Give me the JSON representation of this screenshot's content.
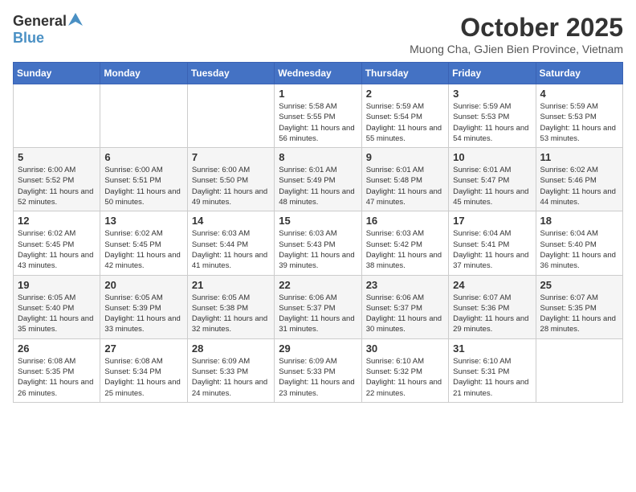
{
  "header": {
    "logo_general": "General",
    "logo_blue": "Blue",
    "month_title": "October 2025",
    "location": "Muong Cha, GJien Bien Province, Vietnam"
  },
  "days_of_week": [
    "Sunday",
    "Monday",
    "Tuesday",
    "Wednesday",
    "Thursday",
    "Friday",
    "Saturday"
  ],
  "weeks": [
    [
      {
        "day": "",
        "info": ""
      },
      {
        "day": "",
        "info": ""
      },
      {
        "day": "",
        "info": ""
      },
      {
        "day": "1",
        "info": "Sunrise: 5:58 AM\nSunset: 5:55 PM\nDaylight: 11 hours and 56 minutes."
      },
      {
        "day": "2",
        "info": "Sunrise: 5:59 AM\nSunset: 5:54 PM\nDaylight: 11 hours and 55 minutes."
      },
      {
        "day": "3",
        "info": "Sunrise: 5:59 AM\nSunset: 5:53 PM\nDaylight: 11 hours and 54 minutes."
      },
      {
        "day": "4",
        "info": "Sunrise: 5:59 AM\nSunset: 5:53 PM\nDaylight: 11 hours and 53 minutes."
      }
    ],
    [
      {
        "day": "5",
        "info": "Sunrise: 6:00 AM\nSunset: 5:52 PM\nDaylight: 11 hours and 52 minutes."
      },
      {
        "day": "6",
        "info": "Sunrise: 6:00 AM\nSunset: 5:51 PM\nDaylight: 11 hours and 50 minutes."
      },
      {
        "day": "7",
        "info": "Sunrise: 6:00 AM\nSunset: 5:50 PM\nDaylight: 11 hours and 49 minutes."
      },
      {
        "day": "8",
        "info": "Sunrise: 6:01 AM\nSunset: 5:49 PM\nDaylight: 11 hours and 48 minutes."
      },
      {
        "day": "9",
        "info": "Sunrise: 6:01 AM\nSunset: 5:48 PM\nDaylight: 11 hours and 47 minutes."
      },
      {
        "day": "10",
        "info": "Sunrise: 6:01 AM\nSunset: 5:47 PM\nDaylight: 11 hours and 45 minutes."
      },
      {
        "day": "11",
        "info": "Sunrise: 6:02 AM\nSunset: 5:46 PM\nDaylight: 11 hours and 44 minutes."
      }
    ],
    [
      {
        "day": "12",
        "info": "Sunrise: 6:02 AM\nSunset: 5:45 PM\nDaylight: 11 hours and 43 minutes."
      },
      {
        "day": "13",
        "info": "Sunrise: 6:02 AM\nSunset: 5:45 PM\nDaylight: 11 hours and 42 minutes."
      },
      {
        "day": "14",
        "info": "Sunrise: 6:03 AM\nSunset: 5:44 PM\nDaylight: 11 hours and 41 minutes."
      },
      {
        "day": "15",
        "info": "Sunrise: 6:03 AM\nSunset: 5:43 PM\nDaylight: 11 hours and 39 minutes."
      },
      {
        "day": "16",
        "info": "Sunrise: 6:03 AM\nSunset: 5:42 PM\nDaylight: 11 hours and 38 minutes."
      },
      {
        "day": "17",
        "info": "Sunrise: 6:04 AM\nSunset: 5:41 PM\nDaylight: 11 hours and 37 minutes."
      },
      {
        "day": "18",
        "info": "Sunrise: 6:04 AM\nSunset: 5:40 PM\nDaylight: 11 hours and 36 minutes."
      }
    ],
    [
      {
        "day": "19",
        "info": "Sunrise: 6:05 AM\nSunset: 5:40 PM\nDaylight: 11 hours and 35 minutes."
      },
      {
        "day": "20",
        "info": "Sunrise: 6:05 AM\nSunset: 5:39 PM\nDaylight: 11 hours and 33 minutes."
      },
      {
        "day": "21",
        "info": "Sunrise: 6:05 AM\nSunset: 5:38 PM\nDaylight: 11 hours and 32 minutes."
      },
      {
        "day": "22",
        "info": "Sunrise: 6:06 AM\nSunset: 5:37 PM\nDaylight: 11 hours and 31 minutes."
      },
      {
        "day": "23",
        "info": "Sunrise: 6:06 AM\nSunset: 5:37 PM\nDaylight: 11 hours and 30 minutes."
      },
      {
        "day": "24",
        "info": "Sunrise: 6:07 AM\nSunset: 5:36 PM\nDaylight: 11 hours and 29 minutes."
      },
      {
        "day": "25",
        "info": "Sunrise: 6:07 AM\nSunset: 5:35 PM\nDaylight: 11 hours and 28 minutes."
      }
    ],
    [
      {
        "day": "26",
        "info": "Sunrise: 6:08 AM\nSunset: 5:35 PM\nDaylight: 11 hours and 26 minutes."
      },
      {
        "day": "27",
        "info": "Sunrise: 6:08 AM\nSunset: 5:34 PM\nDaylight: 11 hours and 25 minutes."
      },
      {
        "day": "28",
        "info": "Sunrise: 6:09 AM\nSunset: 5:33 PM\nDaylight: 11 hours and 24 minutes."
      },
      {
        "day": "29",
        "info": "Sunrise: 6:09 AM\nSunset: 5:33 PM\nDaylight: 11 hours and 23 minutes."
      },
      {
        "day": "30",
        "info": "Sunrise: 6:10 AM\nSunset: 5:32 PM\nDaylight: 11 hours and 22 minutes."
      },
      {
        "day": "31",
        "info": "Sunrise: 6:10 AM\nSunset: 5:31 PM\nDaylight: 11 hours and 21 minutes."
      },
      {
        "day": "",
        "info": ""
      }
    ]
  ]
}
